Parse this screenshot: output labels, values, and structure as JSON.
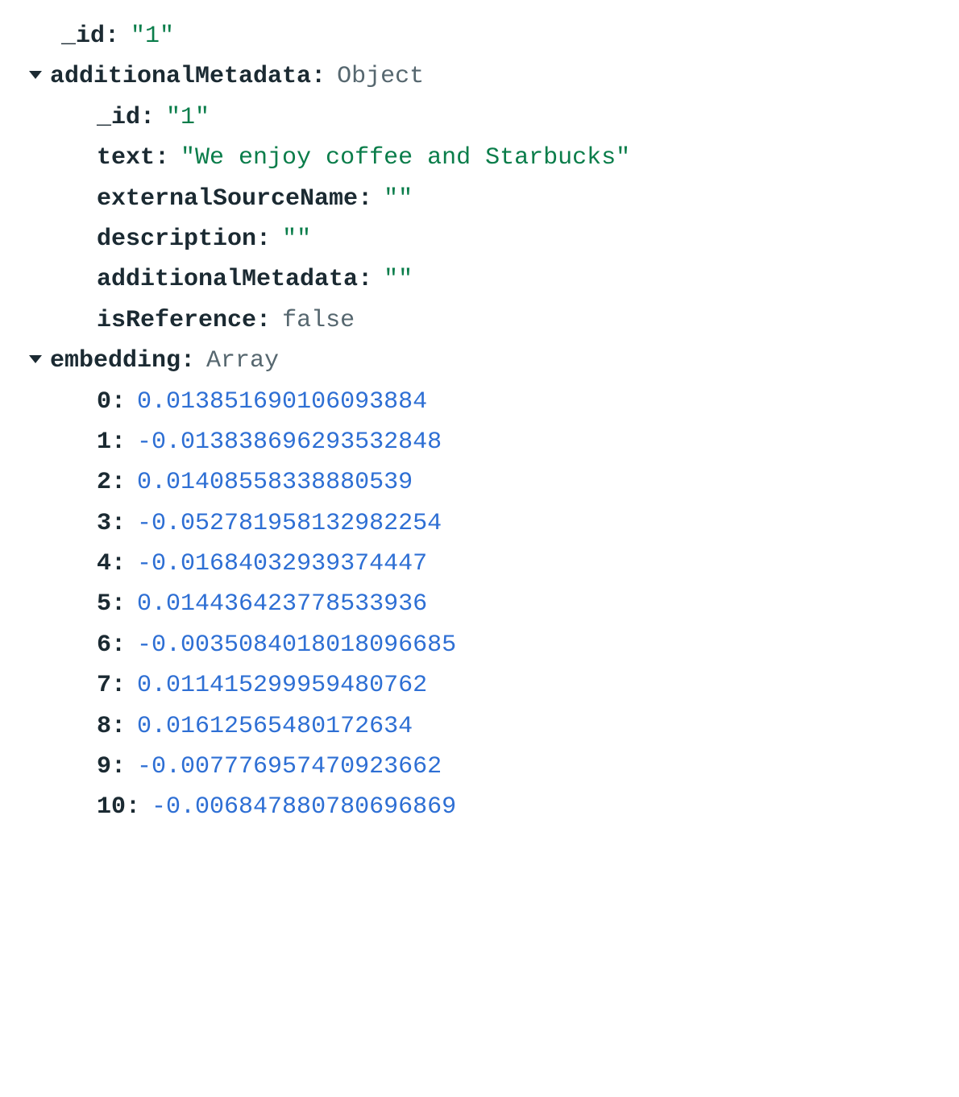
{
  "root": {
    "id_key": "_id",
    "id_value": "\"1\"",
    "additionalMetadata_key": "additionalMetadata",
    "additionalMetadata_type": "Object",
    "additionalMetadata": {
      "id_key": "_id",
      "id_value": "\"1\"",
      "text_key": "text",
      "text_value": "\"We enjoy coffee and Starbucks\"",
      "externalSourceName_key": "externalSourceName",
      "externalSourceName_value": "\"\"",
      "description_key": "description",
      "description_value": "\"\"",
      "additionalMetadata_key": "additionalMetadata",
      "additionalMetadata_value": "\"\"",
      "isReference_key": "isReference",
      "isReference_value": "false"
    },
    "embedding_key": "embedding",
    "embedding_type": "Array",
    "embedding": [
      {
        "idx": "0",
        "val": "0.013851690106093884"
      },
      {
        "idx": "1",
        "val": "-0.013838696293532848"
      },
      {
        "idx": "2",
        "val": "0.01408558338880539"
      },
      {
        "idx": "3",
        "val": "-0.052781958132982254"
      },
      {
        "idx": "4",
        "val": "-0.01684032939374447"
      },
      {
        "idx": "5",
        "val": "0.014436423778533936"
      },
      {
        "idx": "6",
        "val": "-0.0035084018018096685"
      },
      {
        "idx": "7",
        "val": "0.011415299959480762"
      },
      {
        "idx": "8",
        "val": "0.01612565480172634"
      },
      {
        "idx": "9",
        "val": "-0.007776957470923662"
      },
      {
        "idx": "10",
        "val": "-0.006847880780696869"
      }
    ]
  }
}
